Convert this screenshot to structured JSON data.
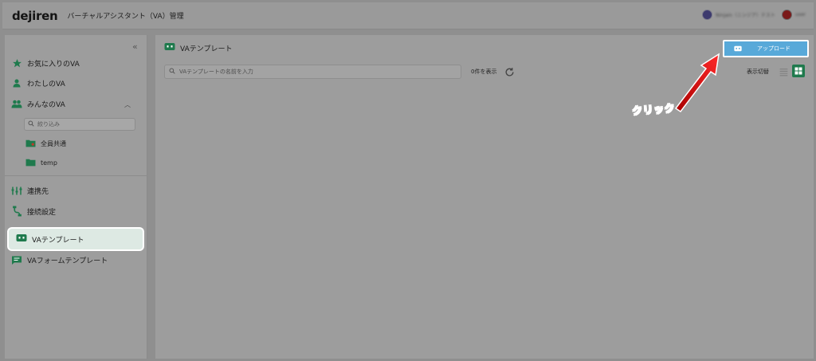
{
  "header": {
    "logo": "dejiren",
    "app_title": "バーチャルアシスタント（VA）管理",
    "org_name_blurred": "Ninjain（ニンジア）テスト",
    "user_name_blurred": "user"
  },
  "sidebar": {
    "items": [
      {
        "label": "お気に入りのVA",
        "icon": "star-icon"
      },
      {
        "label": "わたしのVA",
        "icon": "person-icon"
      },
      {
        "label": "みんなのVA",
        "icon": "people-icon"
      }
    ],
    "filter_placeholder": "絞り込み",
    "sub_items": [
      {
        "label": "全員共通",
        "icon": "shared-folder-icon"
      },
      {
        "label": "temp",
        "icon": "folder-icon"
      }
    ],
    "settings_items": [
      {
        "label": "連携先",
        "icon": "integrations-icon"
      },
      {
        "label": "接続設定",
        "icon": "connection-icon"
      }
    ],
    "template_items": [
      {
        "label": "VAテンプレート",
        "icon": "va-template-icon",
        "active": true
      },
      {
        "label": "VAフォームテンプレート",
        "icon": "form-template-icon",
        "active": false
      }
    ]
  },
  "main": {
    "title": "VAテンプレート",
    "upload_label": "アップロード",
    "search_placeholder": "VAテンプレートの名前を入力",
    "count_text": "0件を表示",
    "view_toggle_label": "表示切替"
  },
  "annotation": {
    "click_label": "クリック",
    "color": "#ff2222"
  },
  "colors": {
    "brand_green": "#1f7a4d",
    "upload_blue": "#58a9d9",
    "active_bg": "#dde9e3"
  }
}
